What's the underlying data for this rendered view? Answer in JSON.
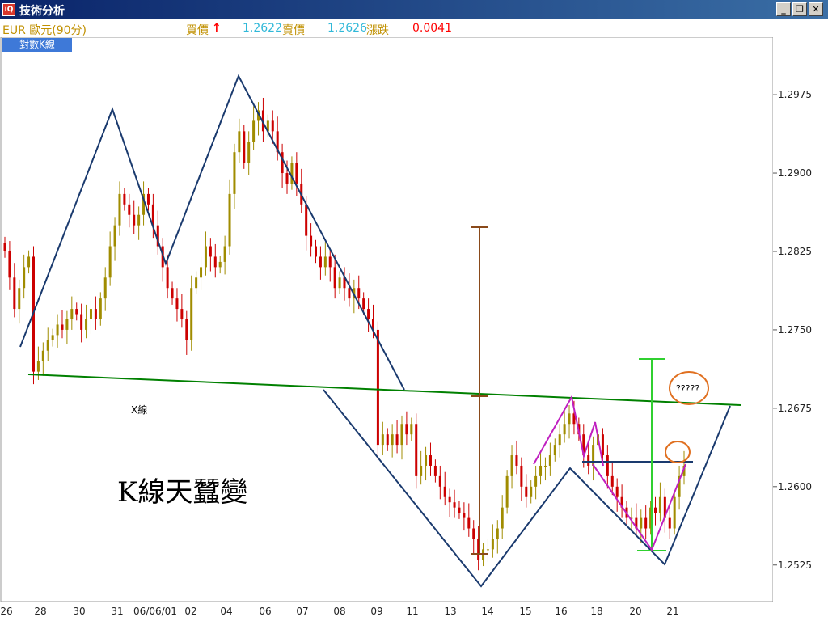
{
  "window": {
    "title": "技術分析",
    "icon": "app-logo-icon",
    "buttons": [
      "minimize-icon",
      "restore-icon",
      "close-icon"
    ]
  },
  "quote": {
    "instrument": "EUR 歐元(90分)",
    "bid_label": "買價",
    "bid_arrow": "↑",
    "bid_value": "1.2622",
    "ask_label": "賣價",
    "ask_value": "1.2626",
    "change_label": "漲跌",
    "change_value": "0.0041"
  },
  "chart_type_label": "對數K線",
  "colors": {
    "up_candle": "#a08c00",
    "down_candle": "#cc0000",
    "pattern_lines": "#1a3a6e",
    "neckline": "#008000",
    "highlight": "#e07020",
    "bid_color": "#c09000",
    "value_color": "#30b8d8",
    "change_color": "#ff0000"
  },
  "chart_data": {
    "type": "candlestick",
    "y_ticks": [
      "1.2975",
      "1.2900",
      "1.2825",
      "1.2750",
      "1.2675",
      "1.2600",
      "1.2525"
    ],
    "x_ticks": [
      "26",
      "28",
      "30",
      "31",
      "06/06/01",
      "02",
      "04",
      "06",
      "07",
      "08",
      "09",
      "11",
      "13",
      "14",
      "15",
      "16",
      "18",
      "20",
      "21"
    ],
    "annotations": {
      "x_line": "X線",
      "pattern_name": "K線天蠶變",
      "question": "?????"
    },
    "ylim": [
      1.249,
      1.303
    ],
    "closes": [
      1.2825,
      1.28,
      1.277,
      1.279,
      1.281,
      1.282,
      1.271,
      1.272,
      1.273,
      1.274,
      1.2745,
      1.2755,
      1.275,
      1.276,
      1.277,
      1.2765,
      1.275,
      1.276,
      1.277,
      1.276,
      1.278,
      1.28,
      1.283,
      1.285,
      1.288,
      1.287,
      1.286,
      1.285,
      1.286,
      1.288,
      1.287,
      1.285,
      1.283,
      1.281,
      1.279,
      1.278,
      1.277,
      1.276,
      1.274,
      1.279,
      1.28,
      1.281,
      1.283,
      1.282,
      1.281,
      1.2815,
      1.283,
      1.288,
      1.292,
      1.294,
      1.291,
      1.293,
      1.295,
      1.296,
      1.294,
      1.295,
      1.294,
      1.292,
      1.29,
      1.289,
      1.291,
      1.289,
      1.287,
      1.284,
      1.283,
      1.282,
      1.281,
      1.282,
      1.281,
      1.279,
      1.28,
      1.279,
      1.278,
      1.279,
      1.278,
      1.277,
      1.276,
      1.275,
      1.264,
      1.265,
      1.264,
      1.265,
      1.264,
      1.266,
      1.265,
      1.266,
      1.261,
      1.262,
      1.263,
      1.262,
      1.261,
      1.26,
      1.259,
      1.2585,
      1.258,
      1.2575,
      1.257,
      1.256,
      1.255,
      1.253,
      1.254,
      1.254,
      1.255,
      1.256,
      1.258,
      1.261,
      1.263,
      1.262,
      1.26,
      1.259,
      1.26,
      1.261,
      1.262,
      1.262,
      1.263,
      1.264,
      1.265,
      1.266,
      1.267,
      1.266,
      1.265,
      1.263,
      1.262,
      1.264,
      1.265,
      1.263,
      1.261,
      1.26,
      1.259,
      1.258,
      1.257,
      1.257,
      1.256,
      1.257,
      1.256,
      1.258,
      1.2575,
      1.259,
      1.257,
      1.256,
      1.259,
      1.261,
      1.262
    ],
    "necklines": [
      {
        "from": [
          "2006-05-26 18:00",
          1.2698
        ],
        "to": [
          "2006-06-21 12:00",
          1.2673
        ],
        "color": "green"
      },
      {
        "from": [
          "2006-06-16 18:00",
          1.2615
        ],
        "to": [
          "2006-06-21 06:00",
          1.2615
        ],
        "color": "navy"
      }
    ]
  }
}
